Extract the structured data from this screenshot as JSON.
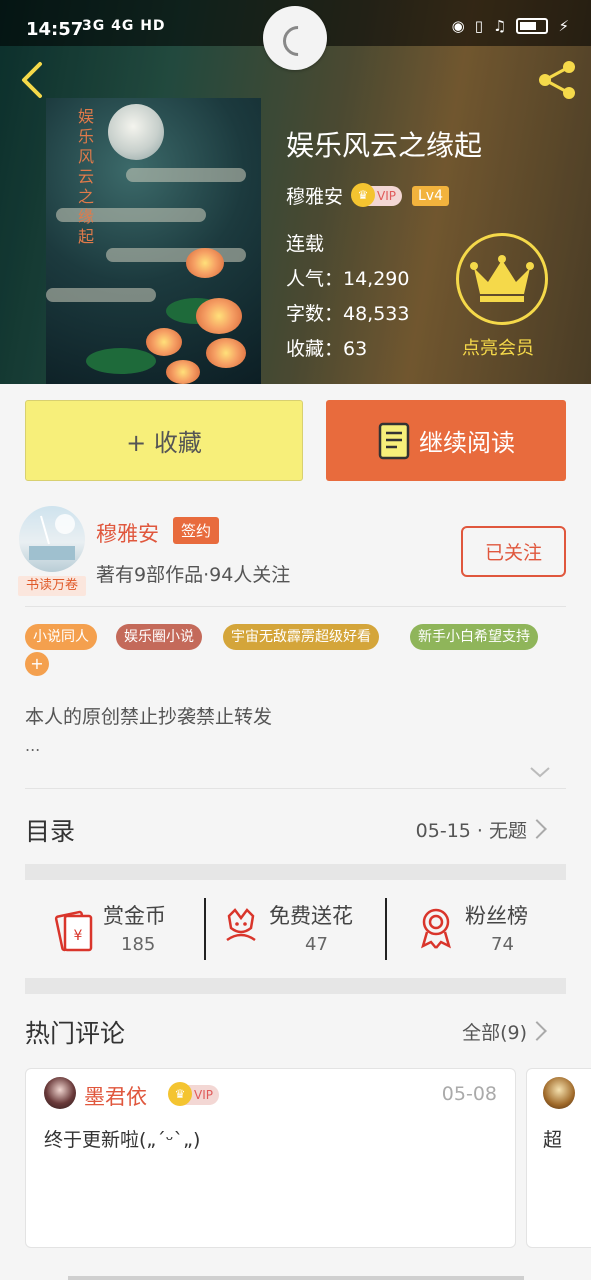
{
  "status_bar": {
    "time": "14:57",
    "network": "3G 4G HD"
  },
  "book": {
    "title": "娱乐风云之缘起",
    "author": "穆雅安",
    "vip": "VIP",
    "level": "Lv4",
    "status": "连载",
    "popularity": "人气：14,290",
    "word_count": "字数：48,533",
    "favorites": "收藏：63",
    "cover_text": "娱乐风云之缘起"
  },
  "member": {
    "label": "点亮会员"
  },
  "actions": {
    "favorite_label": "+ 收藏",
    "continue_label": "继续阅读"
  },
  "author_card": {
    "name": "穆雅安",
    "sign_badge": "签约",
    "avatar_tag": "书读万卷",
    "meta": "著有9部作品·94人关注",
    "follow_label": "已关注"
  },
  "tags": [
    {
      "label": "小说同人",
      "color": "#f4a04e"
    },
    {
      "label": "娱乐圈小说",
      "color": "#c46a5a"
    },
    {
      "label": "宇宙无敌霹雳超级好看",
      "color": "#d4a53a"
    },
    {
      "label": "新手小白希望支持",
      "color": "#8fb55a"
    }
  ],
  "tag_add": "+",
  "intro": {
    "text": "本人的原创禁止抄袭禁止转发",
    "more": "..."
  },
  "catalog": {
    "title": "目录",
    "latest": "05-15 · 无题"
  },
  "stats": [
    {
      "label": "赏金币",
      "value": "185",
      "icon": "red-envelope-icon"
    },
    {
      "label": "免费送花",
      "value": "47",
      "icon": "flower-icon"
    },
    {
      "label": "粉丝榜",
      "value": "74",
      "icon": "medal-icon"
    }
  ],
  "comments": {
    "title": "热门评论",
    "all_label": "全部(9)",
    "items": [
      {
        "user": "墨君依",
        "vip": "VIP",
        "date": "05-08",
        "text": "终于更新啦(„ˊᵕˋ„)"
      },
      {
        "user": "",
        "text": "超"
      }
    ]
  },
  "colors": {
    "accent_orange": "#e86b3d",
    "accent_red": "#e0573d",
    "favorite_yellow": "#f7ef7a",
    "crown_gold": "#f5d94a"
  }
}
